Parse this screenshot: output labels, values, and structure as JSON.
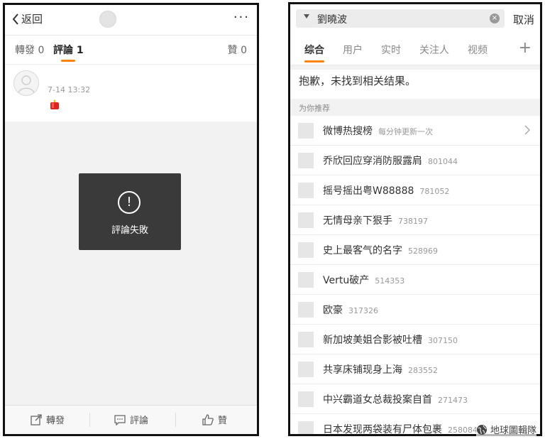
{
  "left": {
    "nav": {
      "back_label": "返回",
      "more_label": "···"
    },
    "tabs": {
      "repost": "轉發 0",
      "comment": "評論 1",
      "like": "贊 0"
    },
    "comment": {
      "time": "7-14 13:32"
    },
    "toast": {
      "icon": "!",
      "message": "評論失敗"
    },
    "bottom": {
      "repost": "轉發",
      "comment": "評論",
      "like": "贊"
    }
  },
  "right": {
    "search": {
      "value": "劉曉波",
      "clear": "×",
      "cancel": "取消"
    },
    "tabs": [
      "综合",
      "用户",
      "实时",
      "关注人",
      "视频"
    ],
    "tab_plus": "+",
    "sorry": "抱歉，未找到相关结果。",
    "recommend_label": "为你推荐",
    "items": [
      {
        "title": "微博热搜榜",
        "sub": "每分钟更新一次"
      },
      {
        "title": "乔欣回应穿消防服露肩",
        "sub": "801044"
      },
      {
        "title": "摇号摇出粤W88888",
        "sub": "781052"
      },
      {
        "title": "无情母亲下狠手",
        "sub": "738197"
      },
      {
        "title": "史上最客气的名字",
        "sub": "528969"
      },
      {
        "title": "Vertu破产",
        "sub": "514353"
      },
      {
        "title": "欧豪",
        "sub": "317326"
      },
      {
        "title": "新加坡美姐合影被吐槽",
        "sub": "307150"
      },
      {
        "title": "共享床铺现身上海",
        "sub": "283552"
      },
      {
        "title": "中兴霸道女总裁投案自首",
        "sub": "271473"
      },
      {
        "title": "日本发现两袋装有尸体包裹",
        "sub": "258084"
      }
    ]
  },
  "watermark": "地球圖輯隊",
  "colors": {
    "accent": "#ff8200",
    "toast": "#3a3a3a"
  }
}
